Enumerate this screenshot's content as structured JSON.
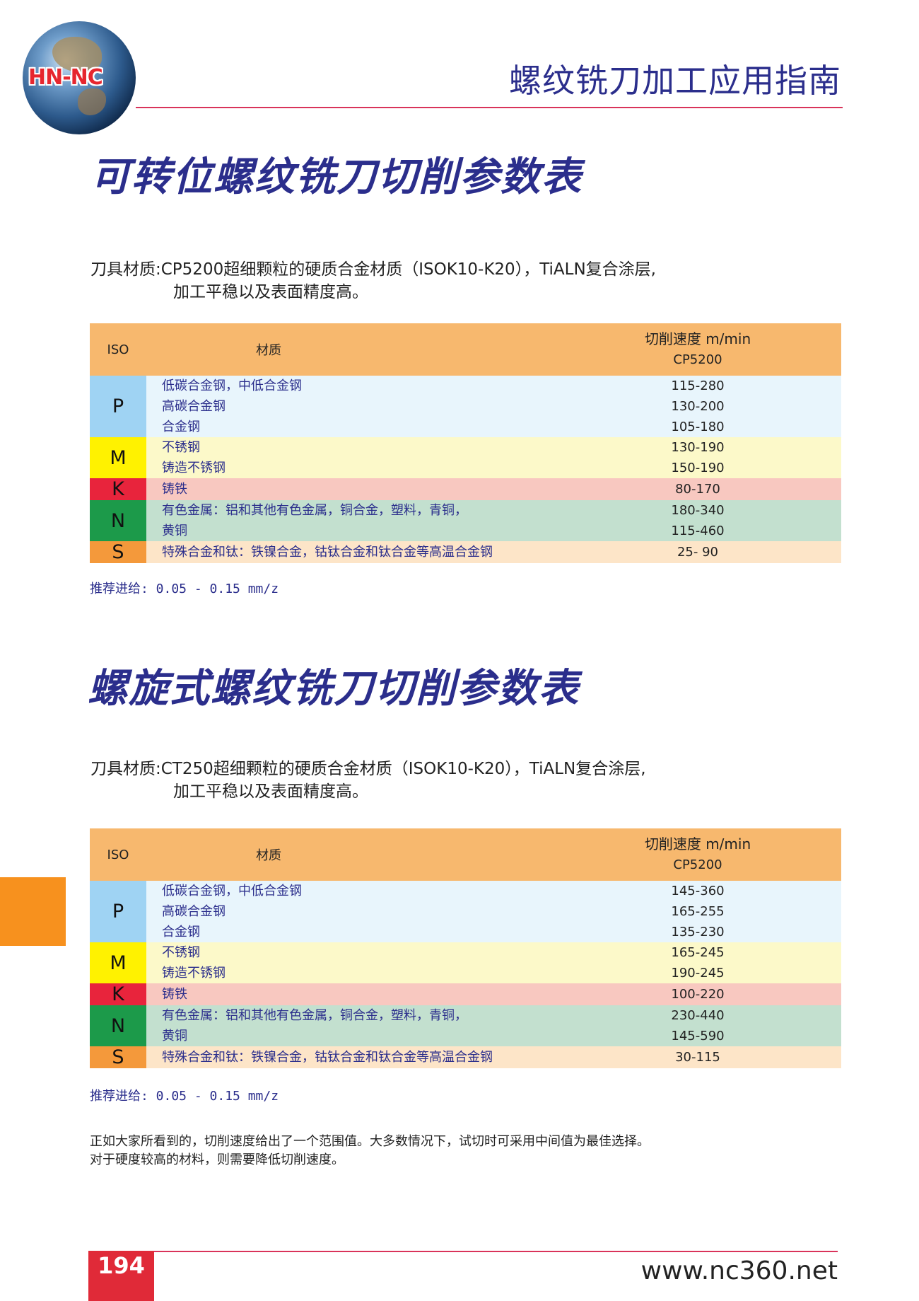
{
  "header": {
    "logo_text": "HN-NC",
    "title": "螺纹铣刀加工应用指南"
  },
  "section1": {
    "title": "可转位螺纹铣刀切削参数表",
    "material_line1": "刀具材质:CP5200超细颗粒的硬质合金材质（ISOK10-K20），TiALN复合涂层,",
    "material_line2": "加工平稳以及表面精度高。",
    "table": {
      "header": {
        "iso": "ISO",
        "material": "材质",
        "speed_label": "切削速度 m/min",
        "grade": "CP5200"
      },
      "groups": [
        {
          "iso": "P",
          "rows": [
            {
              "material": "低碳合金钢，中低合金钢",
              "speed": "115-280"
            },
            {
              "material": "高碳合金钢",
              "speed": "130-200"
            },
            {
              "material": "合金钢",
              "speed": "105-180"
            }
          ]
        },
        {
          "iso": "M",
          "rows": [
            {
              "material": "不锈钢",
              "speed": "130-190"
            },
            {
              "material": "铸造不锈钢",
              "speed": "150-190"
            }
          ]
        },
        {
          "iso": "K",
          "rows": [
            {
              "material": "铸铁",
              "speed": "80-170"
            }
          ]
        },
        {
          "iso": "N",
          "rows": [
            {
              "material": "有色金属：铝和其他有色金属，铜合金，塑料，青铜，",
              "speed": "180-340"
            },
            {
              "material": "黄铜",
              "speed": "115-460"
            }
          ]
        },
        {
          "iso": "S",
          "rows": [
            {
              "material": "特殊合金和钛：铁镍合金，钴钛合金和钛合金等高温合金钢",
              "speed": "25- 90"
            }
          ]
        }
      ]
    },
    "feed_note": "推荐进给: 0.05 - 0.15 mm/z"
  },
  "section2": {
    "title": "螺旋式螺纹铣刀切削参数表",
    "material_line1": "刀具材质:CT250超细颗粒的硬质合金材质（ISOK10-K20），TiALN复合涂层,",
    "material_line2": "加工平稳以及表面精度高。",
    "table": {
      "header": {
        "iso": "ISO",
        "material": "材质",
        "speed_label": "切削速度 m/min",
        "grade": "CP5200"
      },
      "groups": [
        {
          "iso": "P",
          "rows": [
            {
              "material": "低碳合金钢，中低合金钢",
              "speed": "145-360"
            },
            {
              "material": "高碳合金钢",
              "speed": "165-255"
            },
            {
              "material": "合金钢",
              "speed": "135-230"
            }
          ]
        },
        {
          "iso": "M",
          "rows": [
            {
              "material": "不锈钢",
              "speed": "165-245"
            },
            {
              "material": "铸造不锈钢",
              "speed": "190-245"
            }
          ]
        },
        {
          "iso": "K",
          "rows": [
            {
              "material": "铸铁",
              "speed": "100-220"
            }
          ]
        },
        {
          "iso": "N",
          "rows": [
            {
              "material": "有色金属：铝和其他有色金属，铜合金，塑料，青铜，",
              "speed": "230-440"
            },
            {
              "material": "黄铜",
              "speed": "145-590"
            }
          ]
        },
        {
          "iso": "S",
          "rows": [
            {
              "material": "特殊合金和钛：铁镍合金，钴钛合金和钛合金等高温合金钢",
              "speed": "30-115"
            }
          ]
        }
      ]
    },
    "feed_note": "推荐进给: 0.05 - 0.15 mm/z",
    "remark_line1": "正如大家所看到的，切削速度给出了一个范围值。大多数情况下，试切时可采用中间值为最佳选择。",
    "remark_line2": "对于硬度较高的材料，则需要降低切削速度。"
  },
  "footer": {
    "page_number": "194",
    "website": "www.nc360.net"
  },
  "colors": {
    "title_blue": "#2b2e8c",
    "accent_red": "#d9335a",
    "header_orange": "#f7b86e",
    "P": "#9fd3f3",
    "M": "#fff200",
    "K": "#e8243c",
    "N": "#1c9a4a",
    "S": "#f4993b"
  }
}
